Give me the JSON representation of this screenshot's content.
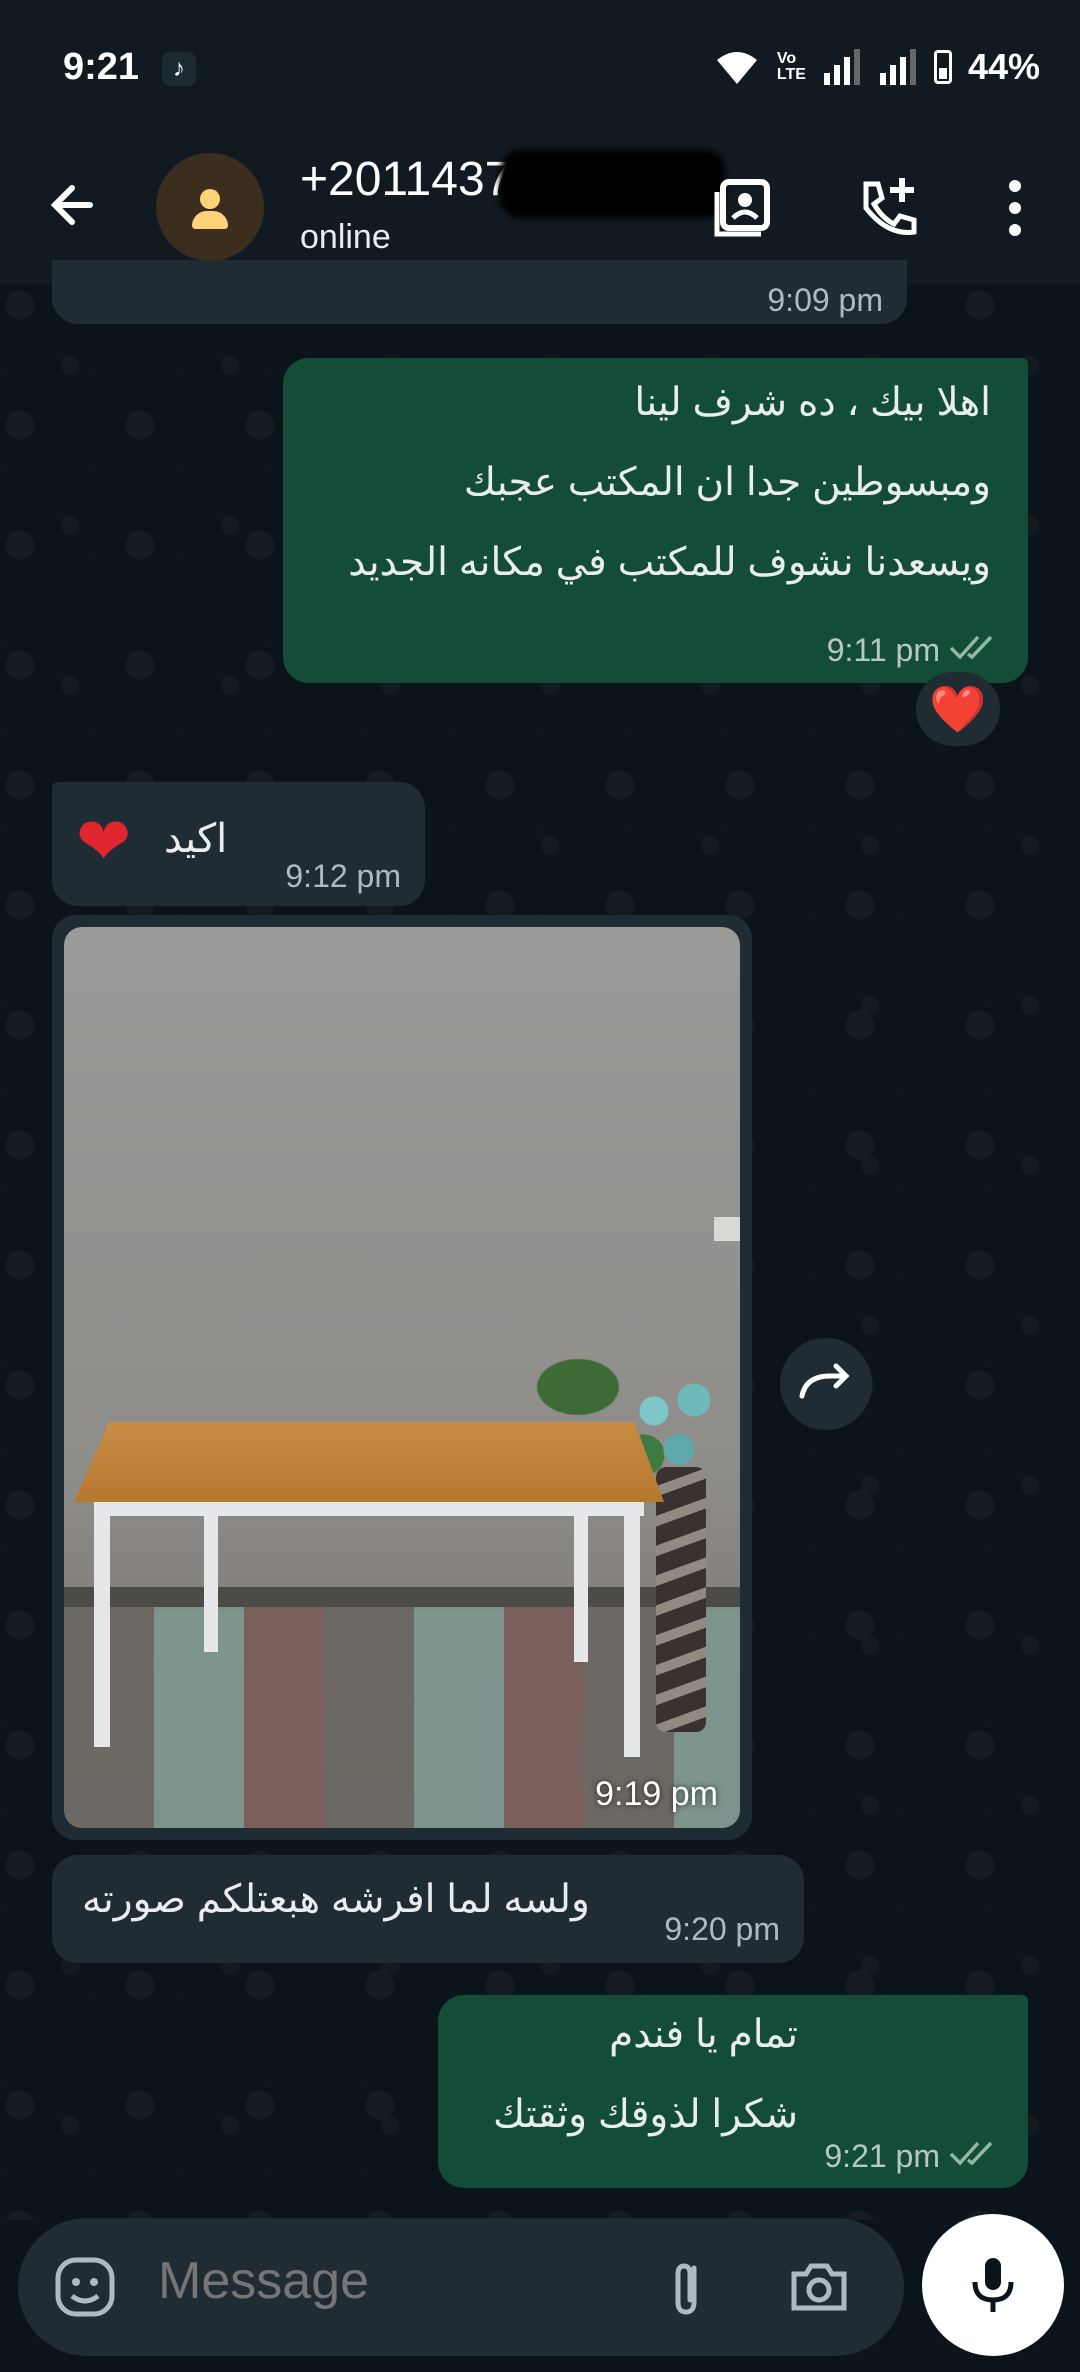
{
  "status_bar": {
    "time": "9:21",
    "volte_top": "Vo",
    "volte_bottom": "LTE",
    "battery": "44%"
  },
  "header": {
    "contact_name": "+2011437",
    "status": "online"
  },
  "messages": {
    "m0_time": "9:09 pm",
    "m1_text": "اهلا بيك ، ده شرف لينا\nومبسوطين جدا ان المكتب عجبك\nويسعدنا نشوف للمكتب في مكانه الجديد",
    "m1_time": "9:11 pm",
    "m1_reaction": "❤️",
    "m2_text": "اكيد",
    "m2_emoji": "❤",
    "m2_time": "9:12 pm",
    "m3_time": "9:19 pm",
    "m4_text": "ولسه لما افرشه هبعتلكم صورته",
    "m4_time": "9:20 pm",
    "m5_text": "تمام يا فندم\nشكرا لذوقك وثقتك",
    "m5_time": "9:21 pm"
  },
  "composer": {
    "placeholder": "Message"
  },
  "icons": {
    "back": "arrow-left-icon",
    "avatar": "person-icon",
    "contact_card": "contact-card-icon",
    "add_call": "add-call-icon",
    "menu": "more-vert-icon",
    "read": "double-check-icon",
    "forward": "forward-icon",
    "emoji": "sticker-icon",
    "attach": "paperclip-icon",
    "camera": "camera-icon",
    "mic": "mic-icon"
  },
  "colors": {
    "outgoing": "#144d37",
    "incoming": "#202c33",
    "read_ticks": "#8696a0",
    "background": "#0b141a"
  }
}
